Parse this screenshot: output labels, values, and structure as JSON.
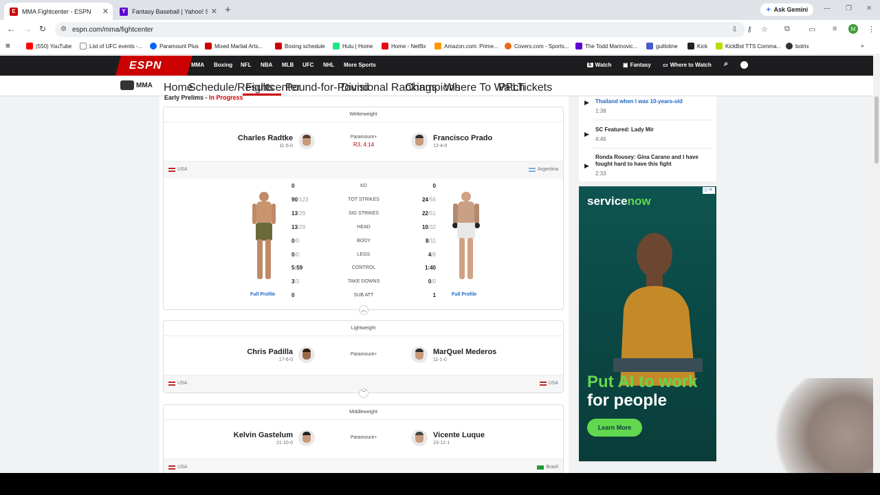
{
  "browser": {
    "tabs": [
      {
        "title": "MMA Fightcenter - ESPN",
        "active": true
      },
      {
        "title": "Fantasy Baseball | Yahoo! Sports",
        "active": false
      }
    ],
    "ask_gemini": "Ask Gemini",
    "url": "espn.com/mma/fightcenter",
    "profile_initial": "M",
    "bookmarks": [
      "(550) YouTube",
      "List of UFC events -...",
      "Paramount Plus",
      "Mixed Martial Arts...",
      "Boxing schedule",
      "Hulu | Home",
      "Home - Netflix",
      "Amazon.com: Prime...",
      "Covers.com - Sports...",
      "The Todd Marinovic...",
      "guillotine",
      "Kick",
      "KickBot TTS Comma...",
      "botrix"
    ]
  },
  "espn": {
    "logo": "ESPN",
    "nav": [
      "MMA",
      "Boxing",
      "NFL",
      "NBA",
      "MLB",
      "UFC",
      "NHL",
      "More Sports"
    ],
    "nav_right": [
      "Watch",
      "Fantasy",
      "Where to Watch"
    ],
    "section_logo": "MMA",
    "subnav": [
      "Home",
      "Schedule/Results",
      "Fightcenter",
      "Pound-for-Pound",
      "Divisional Rankings",
      "Champions",
      "Where To Watch",
      "PFL",
      "Tickets"
    ]
  },
  "section": {
    "title": "Early Prelims - ",
    "status": "In Progress"
  },
  "fights": [
    {
      "weight_class": "Welterweight",
      "left": {
        "name": "Charles Radtke",
        "record": "11-5-0",
        "country": "USA"
      },
      "right": {
        "name": "Francisco Prado",
        "record": "12-4-0",
        "country": "Argentina"
      },
      "broadcast": "Paramount+",
      "result": "R3, 4:14",
      "stats": [
        {
          "label": "KD",
          "l": "0",
          "lt": "",
          "r": "0",
          "rt": ""
        },
        {
          "label": "TOT STRIKES",
          "l": "90",
          "lt": "/123",
          "r": "24",
          "rt": "/56"
        },
        {
          "label": "SIG STRIKES",
          "l": "13",
          "lt": "/29",
          "r": "22",
          "rt": "/51"
        },
        {
          "label": "HEAD",
          "l": "13",
          "lt": "/29",
          "r": "10",
          "rt": "/32"
        },
        {
          "label": "BODY",
          "l": "0",
          "lt": "/0",
          "r": "8",
          "rt": "/11"
        },
        {
          "label": "LEGS",
          "l": "0",
          "lt": "/0",
          "r": "4",
          "rt": "/8"
        },
        {
          "label": "CONTROL",
          "l": "5:59",
          "lt": "",
          "r": "1:40",
          "rt": ""
        },
        {
          "label": "TAKE DOWNS",
          "l": "3",
          "lt": "/3",
          "r": "0",
          "rt": "/0"
        },
        {
          "label": "SUB ATT",
          "l": "0",
          "lt": "",
          "r": "1",
          "rt": ""
        }
      ],
      "full_profile": "Full Profile"
    },
    {
      "weight_class": "Lightweight",
      "left": {
        "name": "Chris Padilla",
        "record": "17-6-0",
        "country": "USA"
      },
      "right": {
        "name": "MarQuel Mederos",
        "record": "11-1-0",
        "country": "USA"
      },
      "broadcast": "Paramount+"
    },
    {
      "weight_class": "Middleweight",
      "left": {
        "name": "Kelvin Gastelum",
        "record": "21-10-0",
        "country": "USA"
      },
      "right": {
        "name": "Vicente Luque",
        "record": "23-12-1",
        "country": "Brazil"
      },
      "broadcast": "Paramount+"
    }
  ],
  "videos": [
    {
      "title": "Thailand when I was 10-years-old",
      "duration": "1:38"
    },
    {
      "title": "SC Featured: Lady Mir",
      "duration": "4:46"
    },
    {
      "title": "Ronda Rousey: Gina Carano and I have fought hard to have this fight",
      "duration": "2:33"
    }
  ],
  "ad": {
    "brand": "servicenow",
    "headline1": "Put AI to work",
    "headline2": "for people",
    "cta": "Learn More",
    "accent": "#62d84e"
  }
}
